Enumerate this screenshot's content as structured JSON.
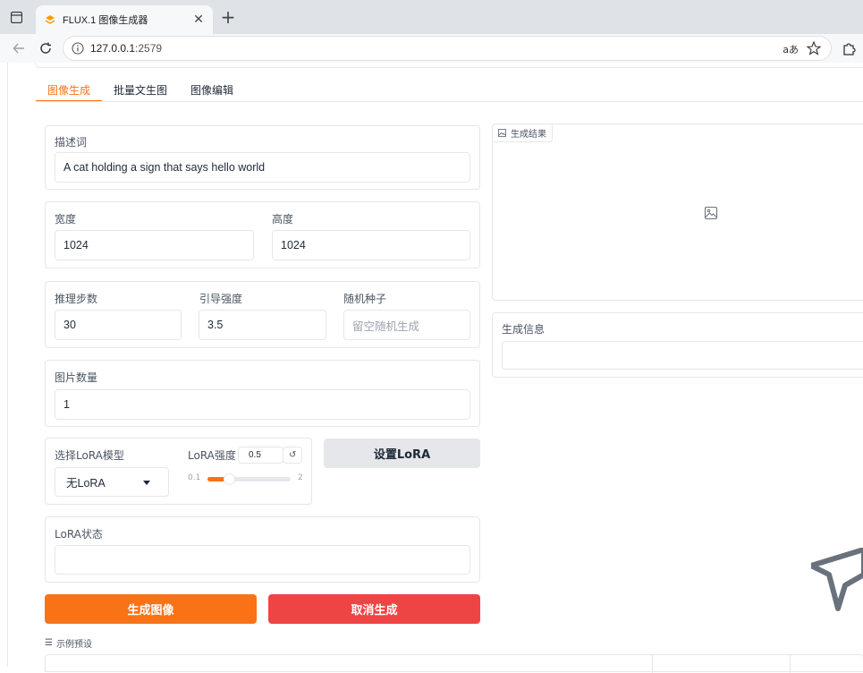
{
  "browser": {
    "tab_title": "FLUX.1 图像生成器",
    "url_host": "127.0.0.1",
    "url_port": ":2579",
    "reader_label": "aあ",
    "accent": "#f97316"
  },
  "app": {
    "tabs": [
      {
        "label": "图像生成",
        "active": true
      },
      {
        "label": "批量文生图",
        "active": false
      },
      {
        "label": "图像编辑",
        "active": false
      }
    ],
    "prompt": {
      "label": "描述词",
      "value": "A cat holding a sign that says hello world"
    },
    "width": {
      "label": "宽度",
      "value": "1024"
    },
    "height": {
      "label": "高度",
      "value": "1024"
    },
    "steps": {
      "label": "推理步数",
      "value": "30"
    },
    "guidance": {
      "label": "引导强度",
      "value": "3.5"
    },
    "seed": {
      "label": "随机种子",
      "placeholder": "留空随机生成"
    },
    "num_images": {
      "label": "图片数量",
      "value": "1"
    },
    "lora_model": {
      "label": "选择LoRA模型",
      "selected": "无LoRA"
    },
    "lora_strength": {
      "label": "LoRA强度",
      "value": "0.5",
      "min": "0.1",
      "max": "2",
      "fraction": 0.21
    },
    "set_lora_button": "设置LoRA",
    "lora_status": {
      "label": "LoRA状态",
      "value": ""
    },
    "generate_button": "生成图像",
    "cancel_button": "取消生成",
    "examples_label": "示例预设",
    "result": {
      "label": "生成结果"
    },
    "info": {
      "label": "生成信息",
      "value": ""
    },
    "colors": {
      "generate": "#f97316",
      "cancel": "#ef4444",
      "secondary_btn": "#e5e7eb"
    }
  }
}
